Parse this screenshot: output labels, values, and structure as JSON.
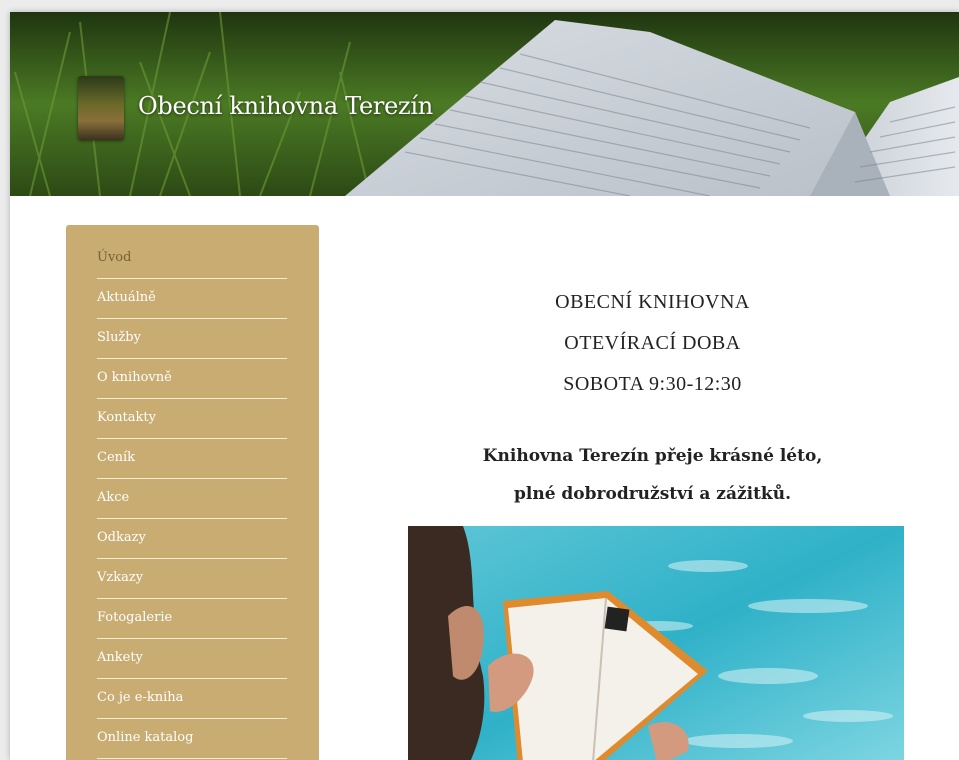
{
  "site": {
    "title": "Obecní knihovna Terezín"
  },
  "nav": {
    "items": [
      {
        "label": "Úvod",
        "active": true
      },
      {
        "label": "Aktuálně"
      },
      {
        "label": "Služby"
      },
      {
        "label": "O knihovně"
      },
      {
        "label": "Kontakty"
      },
      {
        "label": "Ceník"
      },
      {
        "label": "Akce"
      },
      {
        "label": "Odkazy"
      },
      {
        "label": "Vzkazy"
      },
      {
        "label": "Fotogalerie"
      },
      {
        "label": "Ankety"
      },
      {
        "label": "Co je e-kniha"
      },
      {
        "label": "Online katalog"
      }
    ]
  },
  "main": {
    "hours_lines": [
      "OBECNÍ KNIHOVNA",
      "OTEVÍRACÍ DOBA",
      "SOBOTA 9:30-12:30"
    ],
    "greeting_lines": [
      "Knihovna Terezín přeje krásné léto,",
      "plné dobrodružství a zážitků."
    ]
  },
  "colors": {
    "sidebar": "#c8ac72",
    "active_nav": "#7a6030"
  }
}
